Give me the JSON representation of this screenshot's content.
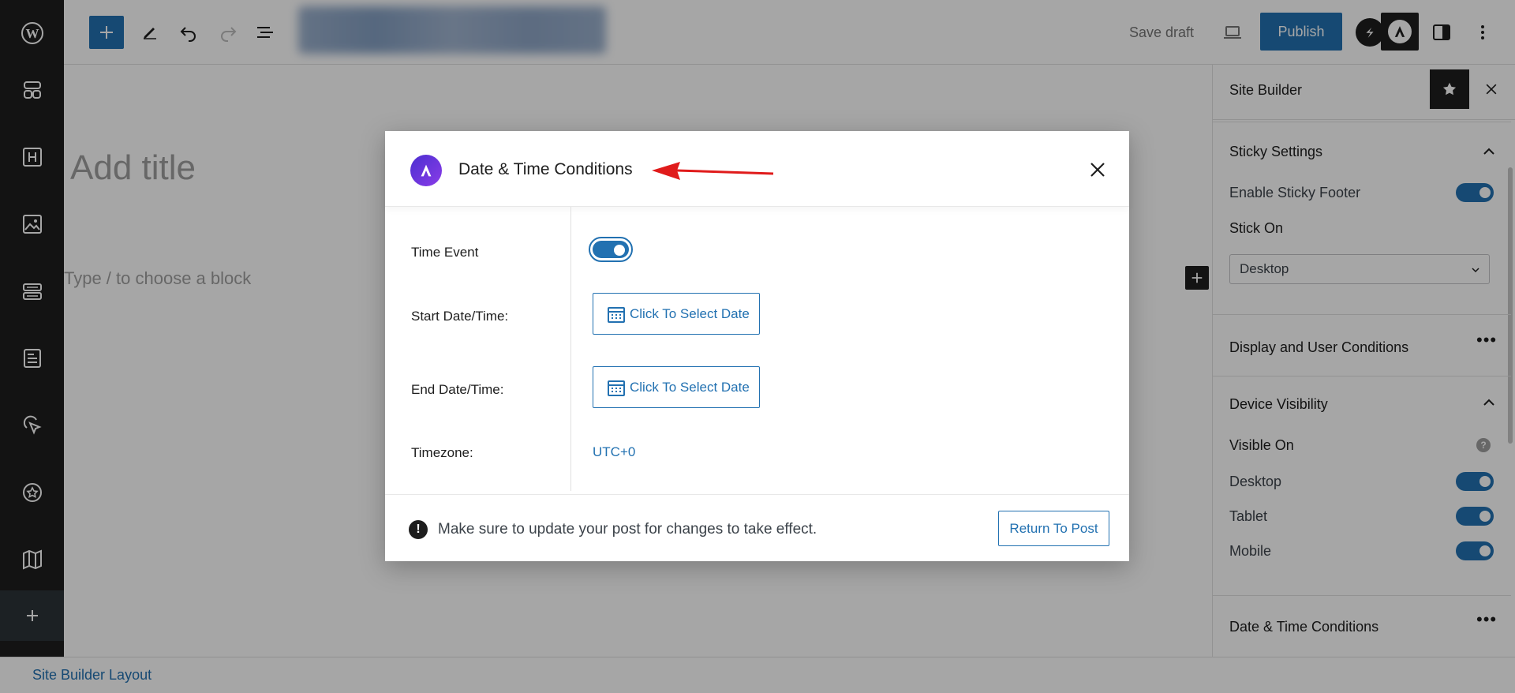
{
  "toolbar": {
    "save_draft_label": "Save draft",
    "publish_label": "Publish"
  },
  "editor": {
    "title_placeholder": "Add title",
    "block_placeholder": "Type / to choose a block"
  },
  "sidebar": {
    "title": "Site Builder",
    "sticky_settings": {
      "heading": "Sticky Settings",
      "enable_sticky_footer_label": "Enable Sticky Footer",
      "enable_sticky_footer_on": true,
      "stick_on_label": "Stick On",
      "stick_on_value": "Desktop"
    },
    "display_conditions_heading": "Display and User Conditions",
    "device_visibility": {
      "heading": "Device Visibility",
      "visible_on_label": "Visible On",
      "devices": [
        {
          "label": "Desktop",
          "on": true
        },
        {
          "label": "Tablet",
          "on": true
        },
        {
          "label": "Mobile",
          "on": true
        }
      ]
    },
    "date_time_heading": "Date & Time Conditions"
  },
  "statusbar": {
    "link_label": "Site Builder Layout"
  },
  "modal": {
    "title": "Date & Time Conditions",
    "time_event_label": "Time Event",
    "time_event_on": true,
    "start_label": "Start Date/Time:",
    "start_button": "Click To Select Date",
    "end_label": "End Date/Time:",
    "end_button": "Click To Select Date",
    "timezone_label": "Timezone:",
    "timezone_value": "UTC+0",
    "footer_note": "Make sure to update your post for changes to take effect.",
    "return_button": "Return To Post"
  },
  "colors": {
    "accent": "#2271b1",
    "dark": "#1e1e1e",
    "annotation_arrow": "#e01b1b",
    "logo_gradient_start": "#4b2fd0",
    "logo_gradient_end": "#8a3ce8"
  },
  "icons": {
    "rail": [
      "wordpress-logo-icon",
      "layout-icon",
      "heading-icon",
      "image-icon",
      "block-icon",
      "form-icon",
      "pointer-icon",
      "badge-icon",
      "map-icon",
      "plus-icon"
    ],
    "toolbar": [
      "plus-icon",
      "pen-icon",
      "undo-icon",
      "redo-icon",
      "list-view-icon",
      "laptop-icon",
      "spectra-icon",
      "astra-icon",
      "sidebar-toggle-icon",
      "more-vertical-icon"
    ]
  }
}
